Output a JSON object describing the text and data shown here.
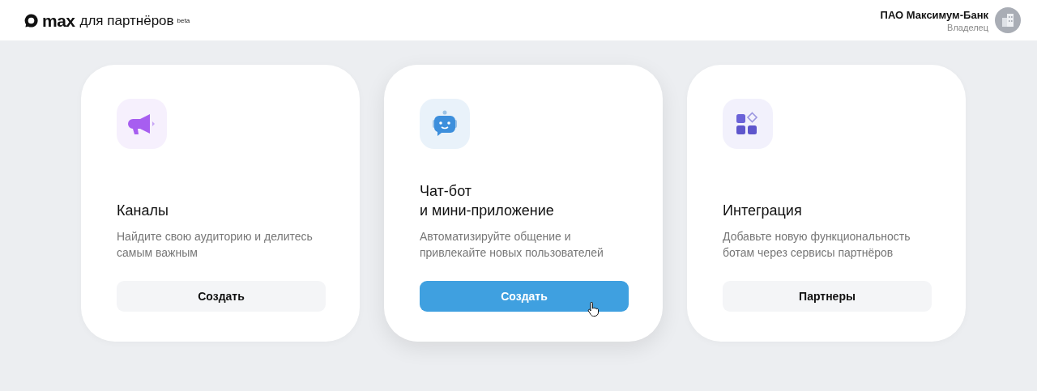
{
  "header": {
    "logo": "max",
    "product": "для партнёров",
    "badge": "beta",
    "org": "ПАО Максимум-Банк",
    "role": "Владелец"
  },
  "cards": [
    {
      "kind": "megaphone",
      "title": "Каналы",
      "description": "Найдите свою аудиторию и делитесь самым важным",
      "button": "Создать",
      "highlighted": false,
      "primary": false
    },
    {
      "kind": "robot",
      "title": "Чат-бот\nи мини-приложение",
      "description": "Автоматизируйте общение и привлекайте новых пользователей",
      "button": "Создать",
      "highlighted": true,
      "primary": true
    },
    {
      "kind": "apps",
      "title": "Интеграция",
      "description": "Добавьте новую функциональность ботам через сервисы партнёров",
      "button": "Партнеры",
      "highlighted": false,
      "primary": false
    }
  ]
}
